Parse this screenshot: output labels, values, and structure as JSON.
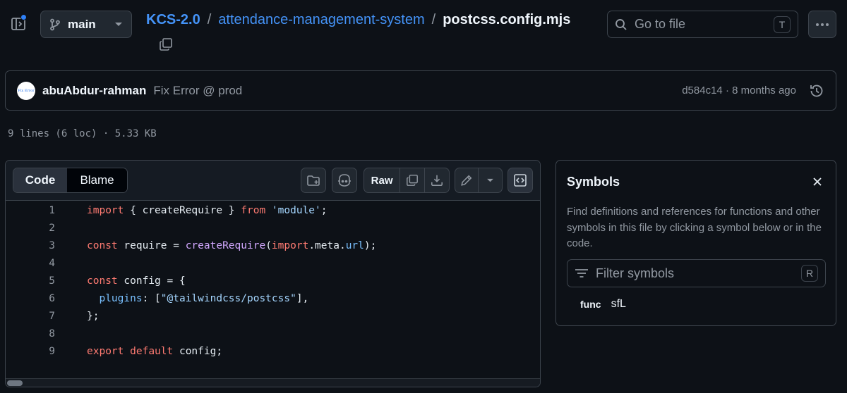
{
  "header": {
    "branch": "main",
    "owner": "KCS-2.0",
    "repo": "attendance-management-system",
    "file": "postcss.config.mjs",
    "separator": "/",
    "search_placeholder": "Go to file",
    "search_shortcut": "T"
  },
  "commit": {
    "author": "abuAbdur-rahman",
    "message": "Fix Error @ prod",
    "meta": "d584c14 · 8 months ago",
    "avatar_text": "Fix Error"
  },
  "file_info": "9 lines (6 loc) · 5.33 KB",
  "toolbar": {
    "code_tab": "Code",
    "blame_tab": "Blame",
    "raw_label": "Raw"
  },
  "code": {
    "line_numbers": [
      "1",
      "2",
      "3",
      "4",
      "5",
      "6",
      "7",
      "8",
      "9"
    ],
    "l1": {
      "kw1": "import",
      "t1": " { createRequire } ",
      "kw2": "from",
      "t2": " ",
      "str": "'module'",
      "t3": ";"
    },
    "l3": {
      "kw": "const",
      "t1": " require = ",
      "fn": "createRequire",
      "t2": "(",
      "kw2": "import",
      "t3": ".meta.",
      "prop": "url",
      "t4": ");"
    },
    "l5": {
      "kw": "const",
      "t1": " config = {"
    },
    "l6": {
      "prop": "plugins",
      "t1": ": [",
      "str": "\"@tailwindcss/postcss\"",
      "t2": "],"
    },
    "l7": {
      "t1": "};"
    },
    "l9": {
      "kw1": "export",
      "t1": " ",
      "kw2": "default",
      "t2": " config;"
    }
  },
  "symbols": {
    "title": "Symbols",
    "description": "Find definitions and references for functions and other symbols in this file by clicking a symbol below or in the code.",
    "filter_placeholder": "Filter symbols",
    "filter_shortcut": "R",
    "items": [
      {
        "kind": "func",
        "name": "sfL"
      }
    ]
  },
  "colors": {
    "background": "#0d1117",
    "link": "#4493f8",
    "keyword": "#ff7b72",
    "string": "#a5d6ff",
    "function": "#d2a8ff",
    "property": "#79c0ff",
    "notification_dot": "#2f81f7"
  },
  "icons": [
    "sidebar-toggle-icon",
    "git-branch-icon",
    "chevron-down-icon",
    "copy-icon",
    "search-icon",
    "kebab-icon",
    "history-icon",
    "copilot-icon",
    "file-plus-icon",
    "download-icon",
    "pencil-icon",
    "symbols-code-icon",
    "close-icon",
    "filter-icon"
  ]
}
